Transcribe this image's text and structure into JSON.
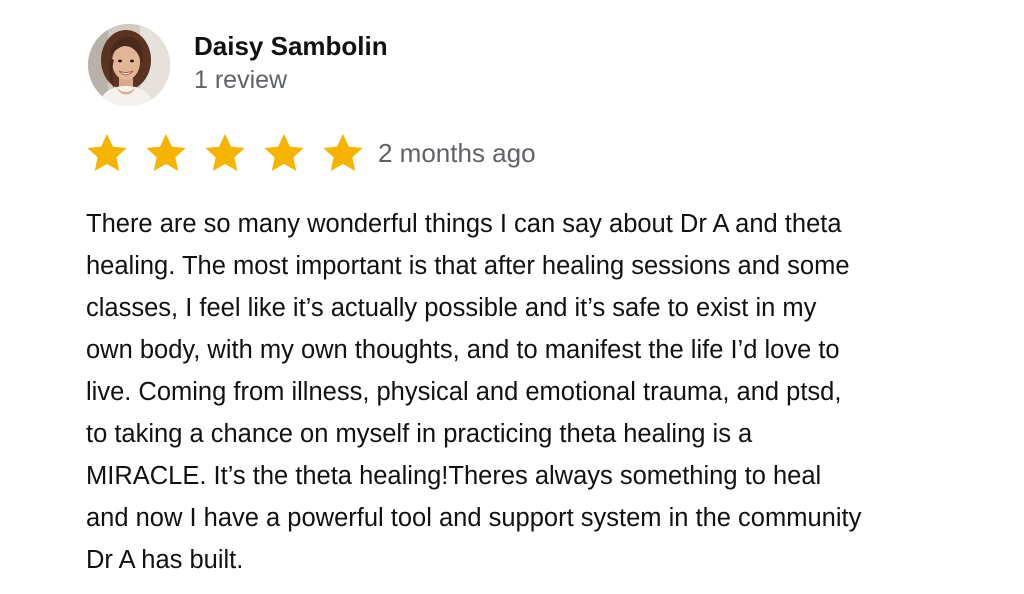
{
  "reviewer": {
    "name": "Daisy Sambolin",
    "review_count": "1 review",
    "avatar_icon": "profile-photo"
  },
  "rating": {
    "stars": 5,
    "max_stars": 5,
    "star_color": "#F5B400",
    "time_ago": "2 months ago"
  },
  "review": {
    "lines": [
      "There are so many wonderful things I can say about Dr A and theta",
      "healing. The most important is that after healing sessions and some",
      "classes, I feel like it’s actually possible and it’s safe to exist in my",
      "own body, with my own thoughts, and to manifest the life I’d love to",
      "live. Coming from illness, physical and emotional trauma, and ptsd,",
      "to taking a chance on myself in practicing theta healing is a",
      "MIRACLE. It’s the theta healing!Theres always something to heal",
      "and now I have a powerful tool and support system in the community",
      "Dr A has built."
    ]
  }
}
